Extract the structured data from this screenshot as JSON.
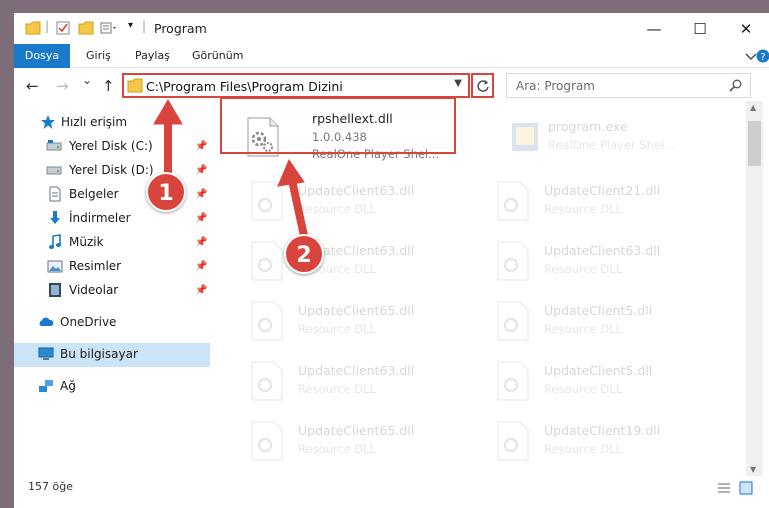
{
  "window": {
    "title": "Program",
    "controls": {
      "minimize": "—",
      "maximize": "☐",
      "close": "✕"
    }
  },
  "ribbon": {
    "tabs": [
      "Dosya",
      "Giriş",
      "Paylaş",
      "Görünüm"
    ]
  },
  "navigation": {
    "back": "←",
    "forward": "→",
    "recent": "⌄",
    "up": "↑",
    "address": "C:\\Program Files\\Program Dizini",
    "search_placeholder": "Ara: Program"
  },
  "sidebar": {
    "items": [
      {
        "label": "Hızlı erişim",
        "icon": "star-icon",
        "pinned": false
      },
      {
        "label": "Yerel Disk (C:)",
        "icon": "drive-icon",
        "pinned": true
      },
      {
        "label": "Yerel Disk (D:)",
        "icon": "drive-icon",
        "pinned": true
      },
      {
        "label": "Belgeler",
        "icon": "documents-icon",
        "pinned": true
      },
      {
        "label": "İndirmeler",
        "icon": "download-icon",
        "pinned": true
      },
      {
        "label": "Müzik",
        "icon": "music-icon",
        "pinned": true
      },
      {
        "label": "Resimler",
        "icon": "pictures-icon",
        "pinned": true
      },
      {
        "label": "Videolar",
        "icon": "videos-icon",
        "pinned": true
      },
      {
        "label": "OneDrive",
        "icon": "onedrive-icon",
        "pinned": false
      },
      {
        "label": "Bu bilgisayar",
        "icon": "computer-icon",
        "pinned": false,
        "selected": true
      },
      {
        "label": "Ağ",
        "icon": "network-icon",
        "pinned": false
      }
    ]
  },
  "files": [
    {
      "name": "rpshellext.dll",
      "version": "1.0.0.438",
      "desc": "RealOne Player Shel...",
      "selected": true
    },
    {
      "name": "program.exe",
      "desc": "RealOne Player Shel...",
      "faded": true
    },
    {
      "name": "UpdateClient63.dll",
      "desc": "Resource DLL",
      "faded": true
    },
    {
      "name": "UpdateClient21.dll",
      "desc": "Resource DLL",
      "faded": true
    },
    {
      "name": "UpdateClient63.dll",
      "desc": "Resource DLL",
      "faded": true
    },
    {
      "name": "UpdateClient63.dll",
      "desc": "Resource DLL",
      "faded": true
    },
    {
      "name": "UpdateClient65.dll",
      "desc": "Resource DLL",
      "faded": true
    },
    {
      "name": "UpdateClient5.dll",
      "desc": "Resource DLL",
      "faded": true
    },
    {
      "name": "UpdateClient63.dll",
      "desc": "Resource DLL",
      "faded": true
    },
    {
      "name": "UpdateClient5.dll",
      "desc": "Resource DLL",
      "faded": true
    },
    {
      "name": "UpdateClient65.dll",
      "desc": "Resource DLL",
      "faded": true
    },
    {
      "name": "UpdateClient19.dll",
      "desc": "Resource DLL",
      "faded": true
    }
  ],
  "status": {
    "count": "157 öğe"
  },
  "callouts": {
    "step1": "1",
    "step2": "2"
  },
  "colors": {
    "accent": "#1979ca",
    "highlight": "#d9443c",
    "selection": "#cce4f7"
  }
}
